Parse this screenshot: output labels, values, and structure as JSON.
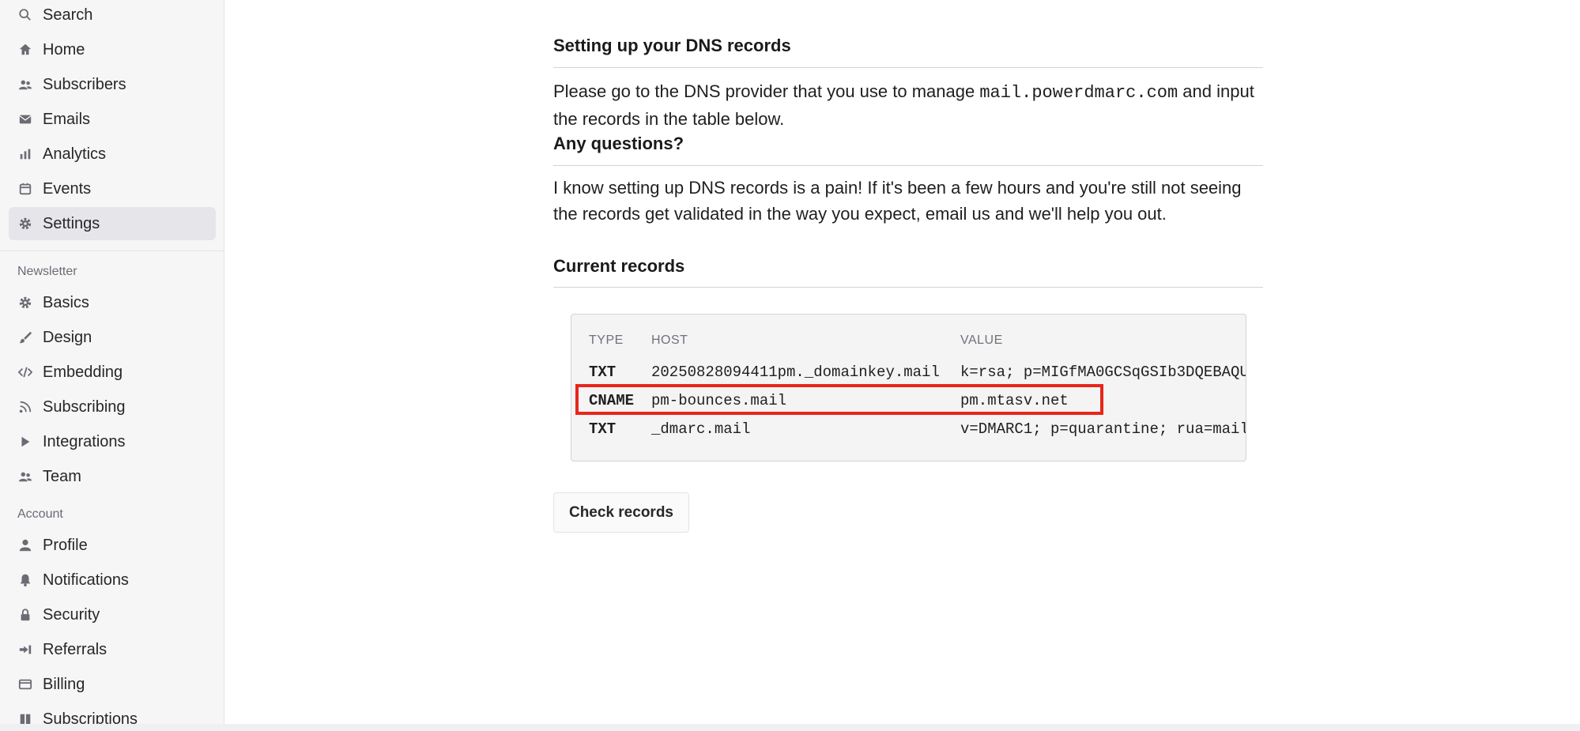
{
  "sidebar": {
    "top_items": [
      {
        "label": "Search",
        "icon": "search-icon"
      },
      {
        "label": "Home",
        "icon": "home-icon"
      },
      {
        "label": "Subscribers",
        "icon": "users-icon"
      },
      {
        "label": "Emails",
        "icon": "mail-icon"
      },
      {
        "label": "Analytics",
        "icon": "bar-chart-icon"
      },
      {
        "label": "Events",
        "icon": "calendar-icon"
      },
      {
        "label": "Settings",
        "icon": "gear-icon",
        "active": true
      }
    ],
    "newsletter_label": "Newsletter",
    "newsletter_items": [
      {
        "label": "Basics",
        "icon": "gear-icon"
      },
      {
        "label": "Design",
        "icon": "brush-icon"
      },
      {
        "label": "Embedding",
        "icon": "code-icon"
      },
      {
        "label": "Subscribing",
        "icon": "rss-icon"
      },
      {
        "label": "Integrations",
        "icon": "play-icon"
      },
      {
        "label": "Team",
        "icon": "users-icon"
      }
    ],
    "account_label": "Account",
    "account_items": [
      {
        "label": "Profile",
        "icon": "user-icon"
      },
      {
        "label": "Notifications",
        "icon": "bell-icon"
      },
      {
        "label": "Security",
        "icon": "lock-icon"
      },
      {
        "label": "Referrals",
        "icon": "referral-icon"
      },
      {
        "label": "Billing",
        "icon": "credit-card-icon"
      },
      {
        "label": "Subscriptions",
        "icon": "book-icon"
      }
    ]
  },
  "main": {
    "dns_heading": "Setting up your DNS records",
    "dns_text_before": "Please go to the DNS provider that you use to manage ",
    "dns_domain": "mail.powerdmarc.com",
    "dns_text_after": " and input the records in the table below.",
    "questions_heading": "Any questions?",
    "questions_text": "I know setting up DNS records is a pain! If it's been a few hours and you're still not seeing the records get validated in the way you expect, email us and we'll help you out.",
    "records_heading": "Current records",
    "table": {
      "headers": [
        "TYPE",
        "HOST",
        "VALUE"
      ],
      "rows": [
        {
          "type": "TXT",
          "host": "20250828094411pm._domainkey.mail",
          "value": "k=rsa; p=MIGfMA0GCSqGSIb3DQEBAQU"
        },
        {
          "type": "CNAME",
          "host": "pm-bounces.mail",
          "value": "pm.mtasv.net"
        },
        {
          "type": "TXT",
          "host": "_dmarc.mail",
          "value": "v=DMARC1; p=quarantine; rua=mail"
        }
      ]
    },
    "check_button": "Check records",
    "highlight_color": "#e8261b"
  }
}
